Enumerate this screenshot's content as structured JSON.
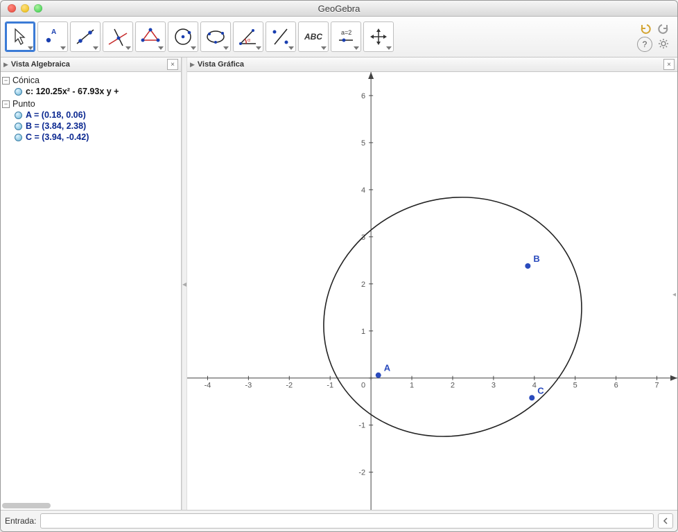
{
  "window": {
    "title": "GeoGebra"
  },
  "toolbar": {
    "tools": [
      {
        "name": "move-tool",
        "selected": true
      },
      {
        "name": "point-tool"
      },
      {
        "name": "line-tool"
      },
      {
        "name": "perpendicular-tool"
      },
      {
        "name": "polygon-tool"
      },
      {
        "name": "circle-tool"
      },
      {
        "name": "conic-tool"
      },
      {
        "name": "angle-tool"
      },
      {
        "name": "reflect-tool"
      },
      {
        "name": "text-tool",
        "label": "ABC"
      },
      {
        "name": "slider-tool",
        "label": "a=2"
      },
      {
        "name": "move-view-tool"
      }
    ]
  },
  "panes": {
    "algebra": {
      "title": "Vista Algebraica"
    },
    "graphics": {
      "title": "Vista Gráfica"
    }
  },
  "algebra": {
    "groups": [
      {
        "name": "Cónica",
        "items": [
          {
            "label": "c: 120.25x² - 67.93x y +",
            "kind": "eq"
          }
        ]
      },
      {
        "name": "Punto",
        "items": [
          {
            "label": "A = (0.18, 0.06)"
          },
          {
            "label": "B = (3.84, 2.38)"
          },
          {
            "label": "C = (3.94, -0.42)"
          }
        ]
      }
    ]
  },
  "chart_data": {
    "type": "scatter",
    "title": "",
    "xlabel": "",
    "ylabel": "",
    "xlim": [
      -4.5,
      7.5
    ],
    "ylim": [
      -2.8,
      6.5
    ],
    "x_ticks": [
      -4,
      -3,
      -2,
      -1,
      0,
      1,
      2,
      3,
      4,
      5,
      6,
      7
    ],
    "y_ticks": [
      -2,
      -1,
      0,
      1,
      2,
      3,
      4,
      5,
      6
    ],
    "series": [
      {
        "name": "A",
        "x": 0.18,
        "y": 0.06
      },
      {
        "name": "B",
        "x": 3.84,
        "y": 2.38
      },
      {
        "name": "C",
        "x": 3.94,
        "y": -0.42
      }
    ],
    "conic": {
      "name": "c",
      "cx": 2.0,
      "cy": 1.3,
      "rx": 3.2,
      "ry": 2.5,
      "rotation_deg": 22
    }
  },
  "input": {
    "label": "Entrada:",
    "value": ""
  }
}
